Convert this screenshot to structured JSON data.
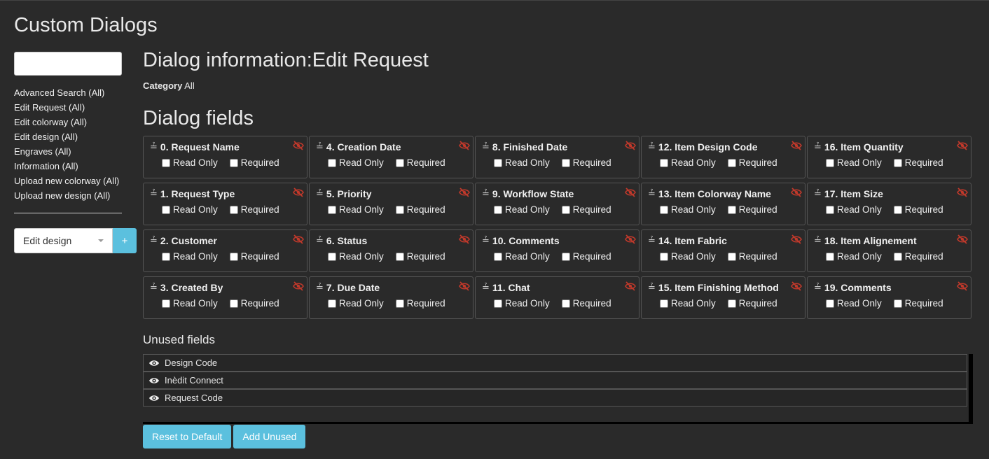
{
  "page_title": "Custom Dialogs",
  "sidebar": {
    "search_value": "",
    "items": [
      "Advanced Search (All)",
      "Edit Request (All)",
      "Edit colorway (All)",
      "Edit design (All)",
      "Engraves (All)",
      "Information (All)",
      "Upload new colorway (All)",
      "Upload new design (All)"
    ],
    "select_value": "Edit design",
    "plus_label": "+"
  },
  "main": {
    "dialog_title": "Dialog information:Edit Request",
    "category_label": "Category",
    "category_value": "All",
    "fields_heading": "Dialog fields",
    "read_only_label": "Read Only",
    "required_label": "Required",
    "columns": [
      [
        "0. Request Name",
        "1. Request Type",
        "2. Customer",
        "3. Created By"
      ],
      [
        "4. Creation Date",
        "5. Priority",
        "6. Status",
        "7. Due Date"
      ],
      [
        "8. Finished Date",
        "9. Workflow State",
        "10. Comments",
        "11. Chat"
      ],
      [
        "12. Item Design Code",
        "13. Item Colorway Name",
        "14. Item Fabric",
        "15. Item Finishing Method"
      ],
      [
        "16. Item Quantity",
        "17. Item Size",
        "18. Item Alignement",
        "19. Comments"
      ]
    ],
    "unused_heading": "Unused fields",
    "unused_fields": [
      "Design Code",
      "Inèdit Connect",
      "Request Code"
    ],
    "reset_label": "Reset to Default",
    "add_unused_label": "Add Unused"
  },
  "colors": {
    "accent": "#5bc0de",
    "hide_icon": "#c0392b",
    "background": "#2a2a2a"
  },
  "icons": {
    "drag": "drag-handle-icon",
    "hide": "eye-slash-icon",
    "show": "eye-icon",
    "caret": "chevron-down-icon"
  }
}
